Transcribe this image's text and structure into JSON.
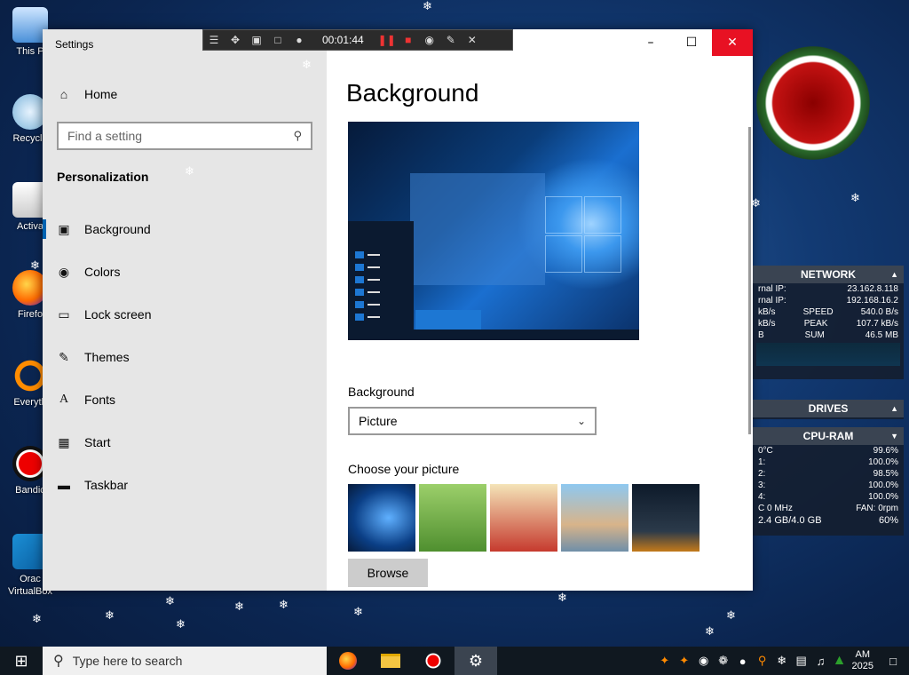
{
  "desktop": {
    "icons": [
      {
        "label": "This P"
      },
      {
        "label": "Recycle"
      },
      {
        "label": "Activa"
      },
      {
        "label": "Firefo"
      },
      {
        "label": "Everyth"
      },
      {
        "label": "Bandic"
      },
      {
        "label": "Orac VirtualBox"
      }
    ]
  },
  "recorder": {
    "timer": "00:01:44"
  },
  "settings": {
    "window_title": "Settings",
    "home_label": "Home",
    "search_placeholder": "Find a setting",
    "section_label": "Personalization",
    "nav": [
      {
        "label": "Background",
        "icon": "picture-icon"
      },
      {
        "label": "Colors",
        "icon": "palette-icon"
      },
      {
        "label": "Lock screen",
        "icon": "lock-screen-icon"
      },
      {
        "label": "Themes",
        "icon": "brush-icon"
      },
      {
        "label": "Fonts",
        "icon": "font-icon"
      },
      {
        "label": "Start",
        "icon": "start-icon"
      },
      {
        "label": "Taskbar",
        "icon": "taskbar-icon"
      }
    ],
    "page_title": "Background",
    "background_label": "Background",
    "background_value": "Picture",
    "choose_label": "Choose your picture",
    "browse_label": "Browse"
  },
  "gadgets": {
    "network": {
      "title": "NETWORK",
      "rows": [
        {
          "left": "rnal IP:",
          "right": "23.162.8.118"
        },
        {
          "left": "rnal IP:",
          "right": "192.168.16.2"
        },
        {
          "left": "kB/s",
          "mid": "SPEED",
          "right": "540.0 B/s"
        },
        {
          "left": "kB/s",
          "mid": "PEAK",
          "right": "107.7 kB/s"
        },
        {
          "left": "B",
          "mid": "SUM",
          "right": "46.5 MB"
        }
      ]
    },
    "drives": {
      "title": "DRIVES"
    },
    "cpuram": {
      "title": "CPU-RAM",
      "temp": "0°C",
      "usage": "99.6%",
      "cores": [
        {
          "label": "1:",
          "value": "100.0%"
        },
        {
          "label": "2:",
          "value": "98.5%"
        },
        {
          "label": "3:",
          "value": "100.0%"
        },
        {
          "label": "4:",
          "value": "100.0%"
        }
      ],
      "freq": "C 0 MHz",
      "fan": "FAN: 0rpm",
      "ram": "2.4 GB/4.0 GB",
      "ram_pct": "60%"
    }
  },
  "taskbar": {
    "search_placeholder": "Type here to search",
    "clock_time": "AM",
    "clock_date": "2025"
  },
  "colors": {
    "accent": "#0063b1",
    "close": "#e81123"
  }
}
